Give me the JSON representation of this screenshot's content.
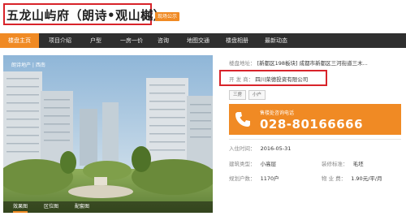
{
  "header": {
    "title": "五龙山屿府（朗诗•观山樾）",
    "badge": "现场公示"
  },
  "nav": {
    "items": [
      {
        "label": "楼盘主页",
        "active": true
      },
      {
        "label": "项目介绍",
        "active": false
      },
      {
        "label": "户型",
        "active": false
      },
      {
        "label": "一房一价",
        "active": false
      },
      {
        "label": "咨询",
        "active": false
      },
      {
        "label": "地图交通",
        "active": false
      },
      {
        "label": "楼盘相册",
        "active": false
      },
      {
        "label": "最新动态",
        "active": false
      }
    ]
  },
  "photo": {
    "brand": "朗诗地产 | 西南",
    "tabs": [
      "效果图",
      "区位图",
      "配套图"
    ]
  },
  "info": {
    "address_label": "楼盘地址：",
    "address_value": "[新都区198板块] 成都市新都区三河街道三木...",
    "developer_label": "开 发 商：",
    "developer_value": "四川荣德投资有限公司",
    "tags": [
      "三房",
      "小户"
    ],
    "phone_label": "售楼处咨询电话",
    "phone_number": "028-80166666",
    "move_in_label": "入住时间：",
    "move_in_value": "2016-05-31",
    "building_type_label": "建筑类型：",
    "building_type_value": "小高层",
    "decoration_label": "装修标准：",
    "decoration_value": "毛坯",
    "households_label": "规划户数：",
    "households_value": "1170户",
    "property_fee_label": "物 业 费：",
    "property_fee_value": "1.90元/平/月"
  },
  "colors": {
    "accent": "#f08a24",
    "nav_bg": "#2f2f2f",
    "highlight_border": "#d8232a"
  }
}
